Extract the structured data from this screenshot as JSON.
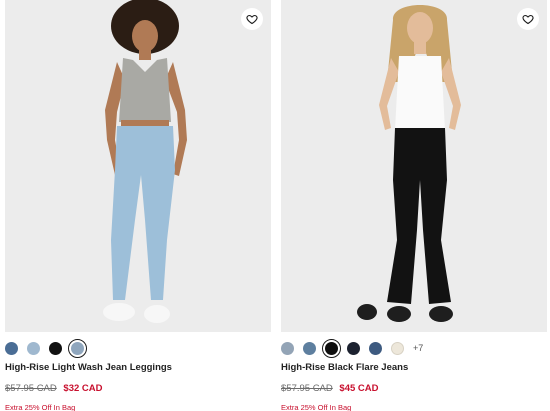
{
  "products": [
    {
      "title": "High-Rise Light Wash Jean Leggings",
      "original_price": "$57.95 CAD",
      "sale_price": "$32 CAD",
      "promo": "Extra 25% Off In Bag",
      "favorite_icon": "heart-outline-icon",
      "swatches": [
        {
          "color": "#4a6d95"
        },
        {
          "color": "#9fb8cf"
        },
        {
          "color": "#111111"
        },
        {
          "color": "#8fa6bd",
          "selected": true
        }
      ]
    },
    {
      "title": "High-Rise Black Flare Jeans",
      "original_price": "$57.95 CAD",
      "sale_price": "$45 CAD",
      "promo": "Extra 25% Off In Bag",
      "favorite_icon": "heart-outline-icon",
      "swatches": [
        {
          "color": "#93a4b6"
        },
        {
          "color": "#5e7f9f"
        },
        {
          "color": "#0e0e0e",
          "selected": true
        },
        {
          "color": "#1c2230"
        },
        {
          "color": "#3d5a80"
        },
        {
          "color": "#ede7da"
        }
      ],
      "more_colors": "+7"
    }
  ],
  "colors": {
    "sale_red": "#c8102e",
    "photo_bg": "#ececec"
  }
}
